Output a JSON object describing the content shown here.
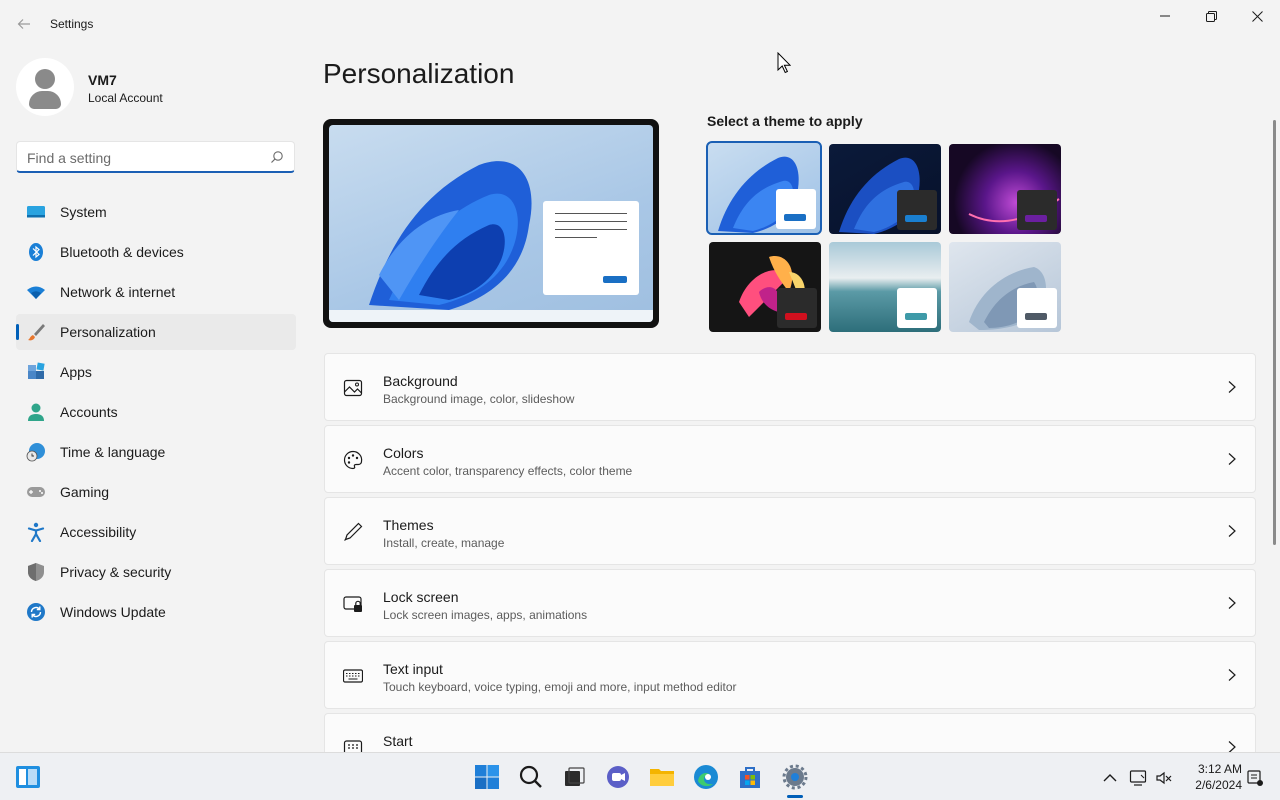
{
  "window": {
    "title": "Settings",
    "controls": {
      "minimize": "minimize-icon",
      "maximize": "restore-icon",
      "close": "close-icon"
    }
  },
  "user": {
    "name": "VM7",
    "account_type": "Local Account"
  },
  "search": {
    "placeholder": "Find a setting",
    "value": ""
  },
  "sidebar": {
    "items": [
      {
        "label": "System",
        "icon": "system-icon"
      },
      {
        "label": "Bluetooth & devices",
        "icon": "bluetooth-icon"
      },
      {
        "label": "Network & internet",
        "icon": "wifi-icon"
      },
      {
        "label": "Personalization",
        "icon": "brush-icon",
        "active": true
      },
      {
        "label": "Apps",
        "icon": "apps-icon"
      },
      {
        "label": "Accounts",
        "icon": "accounts-icon"
      },
      {
        "label": "Time & language",
        "icon": "clock-globe-icon"
      },
      {
        "label": "Gaming",
        "icon": "gamepad-icon"
      },
      {
        "label": "Accessibility",
        "icon": "accessibility-icon"
      },
      {
        "label": "Privacy & security",
        "icon": "shield-icon"
      },
      {
        "label": "Windows Update",
        "icon": "update-icon"
      }
    ]
  },
  "main": {
    "title": "Personalization",
    "theme_heading": "Select a theme to apply",
    "themes": [
      {
        "name": "windows-light",
        "accent": "#1a6fc4",
        "selected": true
      },
      {
        "name": "windows-dark",
        "accent": "#1a6fc4"
      },
      {
        "name": "glow",
        "accent": "#6b1fa0"
      },
      {
        "name": "captured-motion",
        "accent": "#d0101e"
      },
      {
        "name": "sunrise",
        "accent": "#3e9aa8"
      },
      {
        "name": "flow",
        "accent": "#4f5a66"
      }
    ],
    "cards": [
      {
        "title": "Background",
        "desc": "Background image, color, slideshow",
        "icon": "image-icon"
      },
      {
        "title": "Colors",
        "desc": "Accent color, transparency effects, color theme",
        "icon": "palette-icon"
      },
      {
        "title": "Themes",
        "desc": "Install, create, manage",
        "icon": "pen-icon"
      },
      {
        "title": "Lock screen",
        "desc": "Lock screen images, apps, animations",
        "icon": "lock-screen-icon"
      },
      {
        "title": "Text input",
        "desc": "Touch keyboard, voice typing, emoji and more, input method editor",
        "icon": "keyboard-icon"
      },
      {
        "title": "Start",
        "desc": "",
        "icon": "start-icon"
      }
    ]
  },
  "taskbar": {
    "pinned": [
      "start-icon",
      "search-icon",
      "task-view-icon",
      "chat-icon",
      "file-explorer-icon",
      "edge-icon",
      "store-icon",
      "settings-icon"
    ],
    "active": "settings-icon",
    "tray": [
      "chevron-up-icon",
      "network-icon",
      "sound-muted-icon"
    ],
    "time": "3:12 AM",
    "date": "2/6/2024"
  },
  "colors": {
    "accent": "#005fb8",
    "background": "#f3f3f3",
    "card": "#fbfbfb"
  }
}
